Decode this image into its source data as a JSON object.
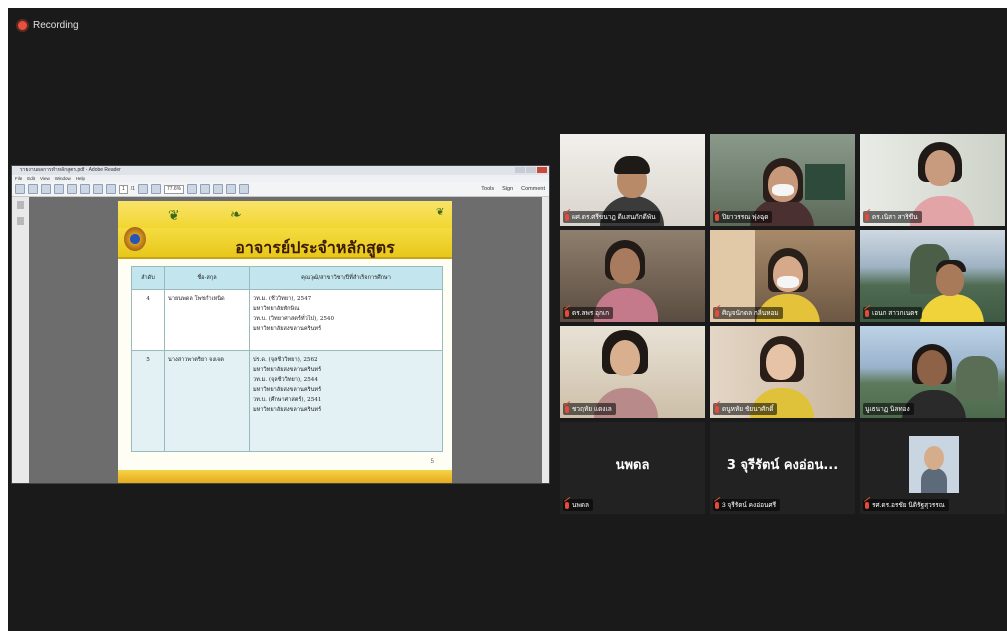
{
  "recording": {
    "label": "Recording",
    "color": "#e8503a"
  },
  "pdf": {
    "title": "รายงานผลการทำหลักสูตร.pdf - Adobe Reader",
    "menu": [
      "File",
      "Edit",
      "View",
      "Window",
      "Help"
    ],
    "page_current": "1",
    "page_total": "/1",
    "zoom": "77.6%",
    "tools": [
      "Tools",
      "Sign",
      "Comment"
    ],
    "slide": {
      "title": "อาจารย์ประจำหลักสูตร",
      "columns": [
        "ลำดับ",
        "ชื่อ-สกุล",
        "คุณวุฒิ/สาขาวิชา/ปีที่สำเร็จการศึกษา"
      ],
      "rows": [
        {
          "idx": "4",
          "name": "นายนพดล โพชกำเหนิด",
          "lines": [
            "วท.ม. (ชีววิทยา), 2547",
            "มหาวิทยาลัยทักษิณ",
            "วท.บ. (วิทยาศาสตร์ทั่วไป), 2540",
            "มหาวิทยาลัยสงขลานครินทร์"
          ]
        },
        {
          "idx": "5",
          "name": "นางสาวพาตริยา จงเจต",
          "lines": [
            "ปร.ด. (จุลชีววิทยา), 2562",
            "มหาวิทยาลัยสงขลานครินทร์",
            "วท.ม. (จุลชีววิทยา), 2544",
            "มหาวิทยาลัยสงขลานครินทร์",
            "วท.บ. (ศึกษาศาสตร์), 2541",
            "มหาวิทยาลัยสงขลานครินทร์"
          ]
        }
      ],
      "page_number": "5"
    }
  },
  "participants": [
    {
      "name": "ผศ.ดร.ศรีขนาฎ ดีแสนภักดีพัน"
    },
    {
      "name": "ปิยาวรรณ ฟุงฉุด"
    },
    {
      "name": "ดร.เนิสา สาริขึน"
    },
    {
      "name": "ดร.ลพร อุกเก"
    },
    {
      "name": "ศิญจนักดล กลิ่นหอม"
    },
    {
      "name": "เอนก สาวกเนตร"
    },
    {
      "name": "ชวฤทัย แดงเล"
    },
    {
      "name": "ดนูหทัย ชัยนาศักดิ์"
    },
    {
      "name": "นูเธนาฏ นิลทอง"
    },
    {
      "name": "นพดล",
      "display": "นพดล"
    },
    {
      "name": "3 จุรีรัตน์ คงอ่อนศรี",
      "display": "3 จุรีรัตน์ คงอ่อน..."
    },
    {
      "name": "รศ.ดร.อรชัย นิติรัฐสุวรรณ"
    }
  ],
  "colors": {
    "active_speaker": "#e5e64a",
    "muted_mic": "#e84a3a"
  }
}
